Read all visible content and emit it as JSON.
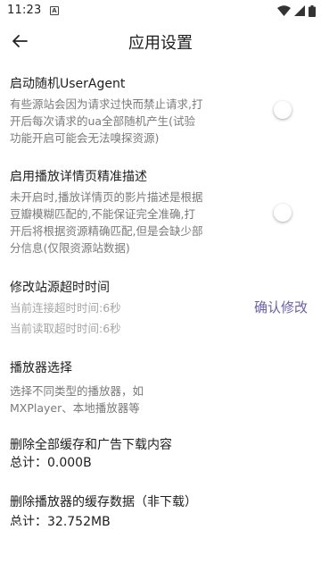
{
  "status_bar": {
    "time": "11:23",
    "notification_badge": "A",
    "icons": [
      "wifi-icon",
      "signal-icon",
      "battery-icon"
    ]
  },
  "header": {
    "title": "应用设置",
    "back_icon": "arrow-left-icon"
  },
  "settings": {
    "random_ua": {
      "title": "启动随机UserAgent",
      "desc": "有些源站会因为请求过快而禁止请求,打开后每次请求的ua全部随机产生(试验功能开启可能会无法嗅探资源)",
      "enabled": false
    },
    "detail_desc": {
      "title": "启用播放详情页精准描述",
      "desc": "未开启时,播放详情页的影片描述是根据豆瓣模糊匹配的,不能保证完全准确,打开后将根据资源精确匹配,但是会缺少部分信息(仅限资源站数据)",
      "enabled": false
    },
    "timeout": {
      "title": "修改站源超时时间",
      "connect_timeout": "当前连接超时时间:6秒",
      "read_timeout": "当前读取超时时间:6秒",
      "confirm_label": "确认修改"
    },
    "player": {
      "title": "播放器选择",
      "desc": "选择不同类型的播放器，如MXPlayer、本地播放器等"
    },
    "clear_cache": {
      "title": "删除全部缓存和广告下载内容",
      "total": "总计：0.000B"
    },
    "clear_player_cache": {
      "title": "删除播放器的缓存数据（非下载）",
      "total": "总计：32.752MB"
    }
  },
  "colors": {
    "accent": "#6b5fa8",
    "secondary_text": "#7a7a7a",
    "disabled_text": "#a6a6a6"
  }
}
